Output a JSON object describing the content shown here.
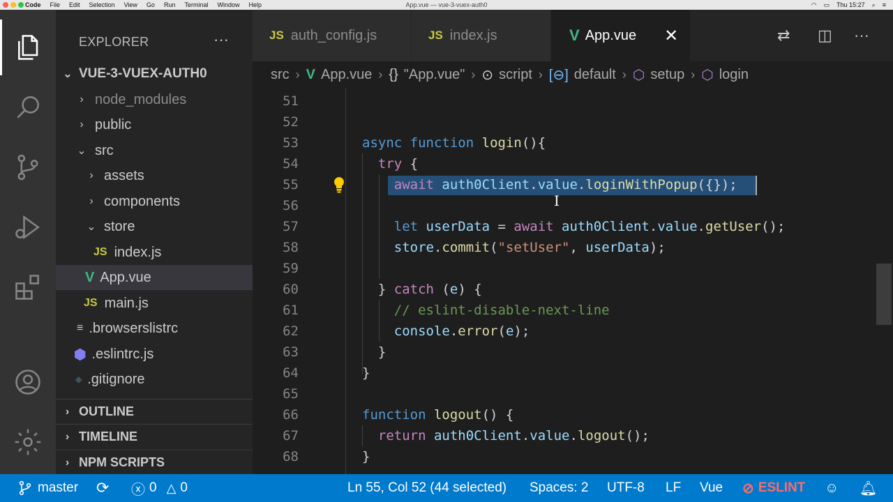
{
  "menubar": {
    "items": [
      "Code",
      "File",
      "Edit",
      "Selection",
      "View",
      "Go",
      "Run",
      "Terminal",
      "Window",
      "Help"
    ],
    "window_title": "App.vue — vue-3-vuex-auth0",
    "clock": "Thu 15:27"
  },
  "activity_bar": {
    "icons": [
      "explorer-icon",
      "search-icon",
      "source-control-icon",
      "run-debug-icon",
      "extensions-icon",
      "account-icon",
      "settings-gear-icon"
    ]
  },
  "explorer": {
    "title": "EXPLORER",
    "more": "···",
    "project": "VUE-3-VUEX-AUTH0",
    "items": [
      {
        "label": "node_modules",
        "chev": "›",
        "icon": ""
      },
      {
        "label": "public",
        "chev": "›",
        "icon": ""
      },
      {
        "label": "src",
        "chev": "⌄",
        "icon": ""
      },
      {
        "label": "assets",
        "chev": "›",
        "icon": ""
      },
      {
        "label": "components",
        "chev": "›",
        "icon": ""
      },
      {
        "label": "store",
        "chev": "⌄",
        "icon": ""
      },
      {
        "label": "index.js",
        "chev": "",
        "icon": "JS"
      },
      {
        "label": "App.vue",
        "chev": "",
        "icon": "V"
      },
      {
        "label": "main.js",
        "chev": "",
        "icon": "JS"
      },
      {
        "label": ".browserslistrc",
        "chev": "",
        "icon": "≡"
      },
      {
        "label": ".eslintrc.js",
        "chev": "",
        "icon": "⬢"
      },
      {
        "label": ".gitignore",
        "chev": "",
        "icon": "◆"
      }
    ],
    "sections": [
      "OUTLINE",
      "TIMELINE",
      "NPM SCRIPTS"
    ]
  },
  "tabs": [
    {
      "label": "auth_config.js",
      "icon": "JS"
    },
    {
      "label": "index.js",
      "icon": "JS"
    },
    {
      "label": "App.vue",
      "icon": "V",
      "close": "✕"
    }
  ],
  "breadcrumb": {
    "parts": [
      "src",
      "App.vue",
      "\"App.vue\"",
      "script",
      "default",
      "setup",
      "login"
    ],
    "icons": {
      "object": "{}",
      "script": "⊙",
      "default": "[⊖]",
      "setup": "⬡",
      "login": "⬡"
    }
  },
  "editor": {
    "lines": [
      {
        "n": "51",
        "code": ""
      },
      {
        "n": "52",
        "code": ""
      },
      {
        "n": "53",
        "code": "async function login(){"
      },
      {
        "n": "54",
        "code": "  try {"
      },
      {
        "n": "55",
        "code": "    await auth0Client.value.loginWithPopup({});"
      },
      {
        "n": "56",
        "code": ""
      },
      {
        "n": "57",
        "code": "    let userData = await auth0Client.value.getUser();"
      },
      {
        "n": "58",
        "code": "    store.commit(\"setUser\", userData);"
      },
      {
        "n": "59",
        "code": ""
      },
      {
        "n": "60",
        "code": "  } catch (e) {"
      },
      {
        "n": "61",
        "code": "    // eslint-disable-next-line"
      },
      {
        "n": "62",
        "code": "    console.error(e);"
      },
      {
        "n": "63",
        "code": "  }"
      },
      {
        "n": "64",
        "code": "}"
      },
      {
        "n": "65",
        "code": ""
      },
      {
        "n": "66",
        "code": "function logout() {"
      },
      {
        "n": "67",
        "code": "  return auth0Client.value.logout();"
      },
      {
        "n": "68",
        "code": "}"
      }
    ]
  },
  "statusbar": {
    "branch": "master",
    "errors": "0",
    "warnings": "0",
    "position": "Ln 55, Col 52 (44 selected)",
    "spaces": "Spaces: 2",
    "encoding": "UTF-8",
    "eol": "LF",
    "language": "Vue",
    "eslint": "ESLINT"
  },
  "colors": {
    "statusbar": "#007acc",
    "editor_bg": "#1e1e1e",
    "sidebar_bg": "#252526",
    "selection": "#264f78",
    "vue_green": "#41b883",
    "js_yellow": "#cbcb41"
  }
}
